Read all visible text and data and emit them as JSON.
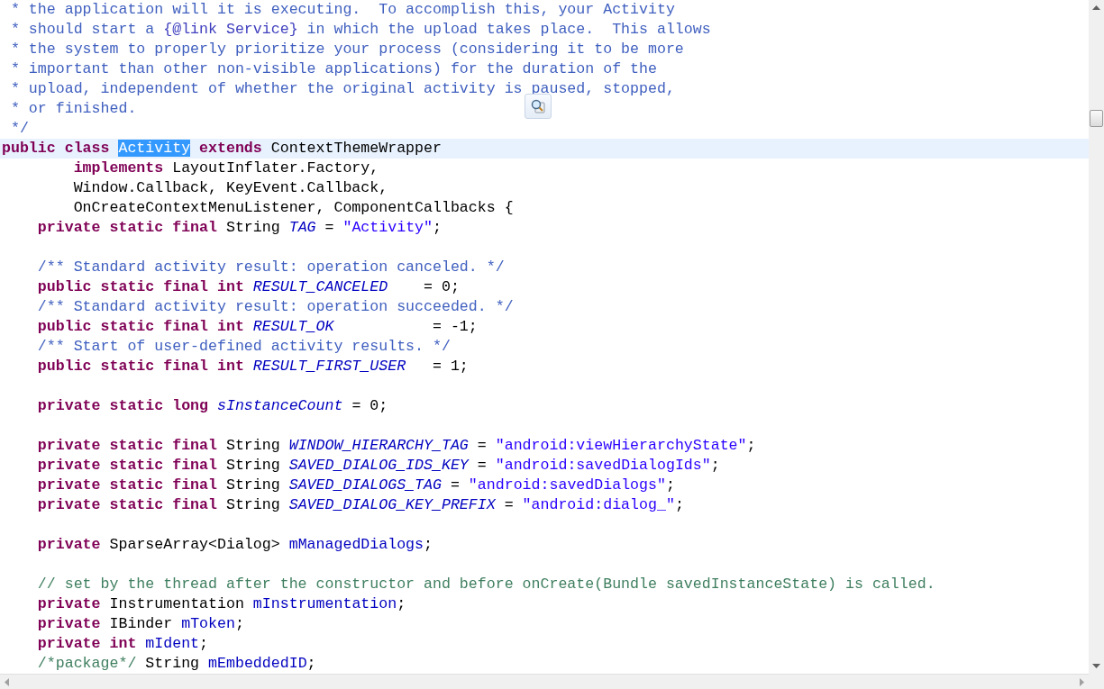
{
  "editor": {
    "lines": [
      {
        "current": false,
        "tokens": [
          {
            "kind": "doc",
            "text": " * the application will it is executing.  To accomplish this, your Activity"
          }
        ]
      },
      {
        "current": false,
        "tokens": [
          {
            "kind": "doc",
            "text": " * should start a "
          },
          {
            "kind": "doctag",
            "text": "{@link Service}"
          },
          {
            "kind": "doc",
            "text": " in which the upload takes place.  This allows"
          }
        ]
      },
      {
        "current": false,
        "tokens": [
          {
            "kind": "doc",
            "text": " * the system to properly prioritize your process (considering it to be more"
          }
        ]
      },
      {
        "current": false,
        "tokens": [
          {
            "kind": "doc",
            "text": " * important than other non-visible applications) for the duration of the"
          }
        ]
      },
      {
        "current": false,
        "tokens": [
          {
            "kind": "doc",
            "text": " * upload, independent of whether the original activity is paused, stopped,"
          }
        ]
      },
      {
        "current": false,
        "tokens": [
          {
            "kind": "doc",
            "text": " * or finished."
          }
        ]
      },
      {
        "current": false,
        "tokens": [
          {
            "kind": "doc",
            "text": " */"
          }
        ]
      },
      {
        "current": true,
        "tokens": [
          {
            "kind": "keyword",
            "text": "public class "
          },
          {
            "kind": "selection",
            "text": "Activity"
          },
          {
            "kind": "keyword",
            "text": " extends"
          },
          {
            "kind": "plain",
            "text": " ContextThemeWrapper"
          }
        ]
      },
      {
        "current": false,
        "tokens": [
          {
            "kind": "keyword",
            "text": "        implements"
          },
          {
            "kind": "plain",
            "text": " LayoutInflater.Factory,"
          }
        ]
      },
      {
        "current": false,
        "tokens": [
          {
            "kind": "plain",
            "text": "        Window.Callback, KeyEvent.Callback,"
          }
        ]
      },
      {
        "current": false,
        "tokens": [
          {
            "kind": "plain",
            "text": "        OnCreateContextMenuListener, ComponentCallbacks {"
          }
        ]
      },
      {
        "current": false,
        "tokens": [
          {
            "kind": "keyword",
            "text": "    private static final"
          },
          {
            "kind": "plain",
            "text": " String "
          },
          {
            "kind": "static-field",
            "text": "TAG"
          },
          {
            "kind": "plain",
            "text": " = "
          },
          {
            "kind": "string",
            "text": "\"Activity\""
          },
          {
            "kind": "plain",
            "text": ";"
          }
        ]
      },
      {
        "current": false
      },
      {
        "current": false,
        "tokens": [
          {
            "kind": "doc",
            "text": "    /** Standard activity result: operation canceled. */"
          }
        ]
      },
      {
        "current": false,
        "tokens": [
          {
            "kind": "keyword",
            "text": "    public static final int "
          },
          {
            "kind": "static-field",
            "text": "RESULT_CANCELED"
          },
          {
            "kind": "plain",
            "text": "    = 0;"
          }
        ]
      },
      {
        "current": false,
        "tokens": [
          {
            "kind": "doc",
            "text": "    /** Standard activity result: operation succeeded. */"
          }
        ]
      },
      {
        "current": false,
        "tokens": [
          {
            "kind": "keyword",
            "text": "    public static final int "
          },
          {
            "kind": "static-field",
            "text": "RESULT_OK"
          },
          {
            "kind": "plain",
            "text": "           = -1;"
          }
        ]
      },
      {
        "current": false,
        "tokens": [
          {
            "kind": "doc",
            "text": "    /** Start of user-defined activity results. */"
          }
        ]
      },
      {
        "current": false,
        "tokens": [
          {
            "kind": "keyword",
            "text": "    public static final int "
          },
          {
            "kind": "static-field",
            "text": "RESULT_FIRST_USER"
          },
          {
            "kind": "plain",
            "text": "   = 1;"
          }
        ]
      },
      {
        "current": false
      },
      {
        "current": false,
        "tokens": [
          {
            "kind": "keyword",
            "text": "    private static long "
          },
          {
            "kind": "static-field",
            "text": "sInstanceCount"
          },
          {
            "kind": "plain",
            "text": " = 0;"
          }
        ]
      },
      {
        "current": false
      },
      {
        "current": false,
        "tokens": [
          {
            "kind": "keyword",
            "text": "    private static final"
          },
          {
            "kind": "plain",
            "text": " String "
          },
          {
            "kind": "static-field",
            "text": "WINDOW_HIERARCHY_TAG"
          },
          {
            "kind": "plain",
            "text": " = "
          },
          {
            "kind": "string",
            "text": "\"android:viewHierarchyState\""
          },
          {
            "kind": "plain",
            "text": ";"
          }
        ]
      },
      {
        "current": false,
        "tokens": [
          {
            "kind": "keyword",
            "text": "    private static final"
          },
          {
            "kind": "plain",
            "text": " String "
          },
          {
            "kind": "static-field",
            "text": "SAVED_DIALOG_IDS_KEY"
          },
          {
            "kind": "plain",
            "text": " = "
          },
          {
            "kind": "string",
            "text": "\"android:savedDialogIds\""
          },
          {
            "kind": "plain",
            "text": ";"
          }
        ]
      },
      {
        "current": false,
        "tokens": [
          {
            "kind": "keyword",
            "text": "    private static final"
          },
          {
            "kind": "plain",
            "text": " String "
          },
          {
            "kind": "static-field",
            "text": "SAVED_DIALOGS_TAG"
          },
          {
            "kind": "plain",
            "text": " = "
          },
          {
            "kind": "string",
            "text": "\"android:savedDialogs\""
          },
          {
            "kind": "plain",
            "text": ";"
          }
        ]
      },
      {
        "current": false,
        "tokens": [
          {
            "kind": "keyword",
            "text": "    private static final"
          },
          {
            "kind": "plain",
            "text": " String "
          },
          {
            "kind": "static-field",
            "text": "SAVED_DIALOG_KEY_PREFIX"
          },
          {
            "kind": "plain",
            "text": " = "
          },
          {
            "kind": "string",
            "text": "\"android:dialog_\""
          },
          {
            "kind": "plain",
            "text": ";"
          }
        ]
      },
      {
        "current": false
      },
      {
        "current": false,
        "tokens": [
          {
            "kind": "keyword",
            "text": "    private"
          },
          {
            "kind": "plain",
            "text": " SparseArray<Dialog> "
          },
          {
            "kind": "field",
            "text": "mManagedDialogs"
          },
          {
            "kind": "plain",
            "text": ";"
          }
        ]
      },
      {
        "current": false
      },
      {
        "current": false,
        "tokens": [
          {
            "kind": "comment",
            "text": "    // set by the thread after the constructor and before onCreate(Bundle savedInstanceState) is called."
          }
        ]
      },
      {
        "current": false,
        "tokens": [
          {
            "kind": "keyword",
            "text": "    private"
          },
          {
            "kind": "plain",
            "text": " Instrumentation "
          },
          {
            "kind": "field",
            "text": "mInstrumentation"
          },
          {
            "kind": "plain",
            "text": ";"
          }
        ]
      },
      {
        "current": false,
        "tokens": [
          {
            "kind": "keyword",
            "text": "    private"
          },
          {
            "kind": "plain",
            "text": " IBinder "
          },
          {
            "kind": "field",
            "text": "mToken"
          },
          {
            "kind": "plain",
            "text": ";"
          }
        ]
      },
      {
        "current": false,
        "tokens": [
          {
            "kind": "keyword",
            "text": "    private int "
          },
          {
            "kind": "field",
            "text": "mIdent"
          },
          {
            "kind": "plain",
            "text": ";"
          }
        ]
      },
      {
        "current": false,
        "tokens": [
          {
            "kind": "comment",
            "text": "    /*package*/"
          },
          {
            "kind": "plain",
            "text": " String "
          },
          {
            "kind": "field",
            "text": "mEmbeddedID"
          },
          {
            "kind": "plain",
            "text": ";"
          }
        ]
      }
    ]
  }
}
